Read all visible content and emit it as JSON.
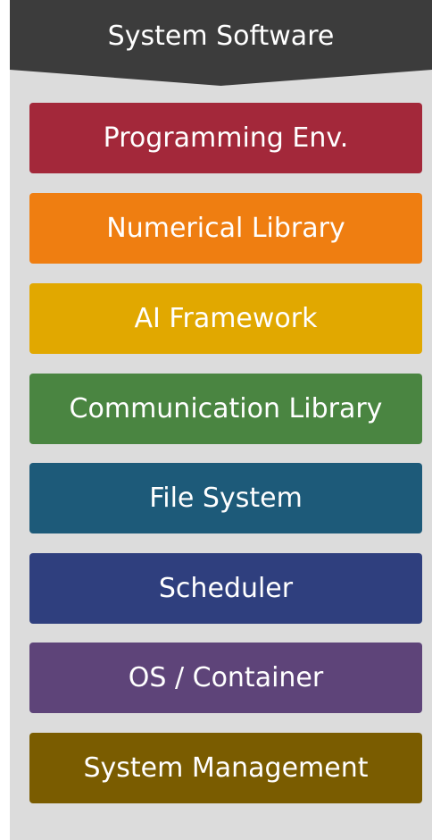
{
  "header": {
    "title": "System Software",
    "color": "#3c3c3c"
  },
  "panel": {
    "background": "#dcdcdc"
  },
  "layers": [
    {
      "label": "Programming Env.",
      "color": "#a3283a"
    },
    {
      "label": "Numerical Library",
      "color": "#ef7e11"
    },
    {
      "label": "AI Framework",
      "color": "#e1a800"
    },
    {
      "label": "Communication Library",
      "color": "#4a8541"
    },
    {
      "label": "File System",
      "color": "#1d5a79"
    },
    {
      "label": "Scheduler",
      "color": "#2f3f7e"
    },
    {
      "label": "OS / Container",
      "color": "#5e4479"
    },
    {
      "label": "System Management",
      "color": "#7a5c00"
    }
  ]
}
